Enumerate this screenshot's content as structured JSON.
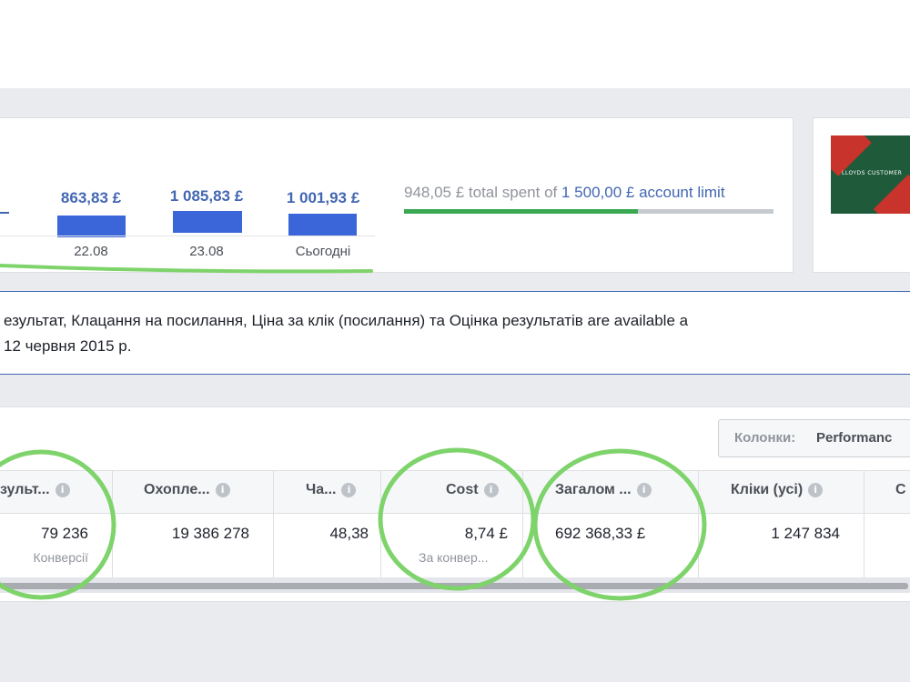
{
  "spend_chart": {
    "bars": [
      {
        "value": "863,83 £",
        "date": "22.08"
      },
      {
        "value": "1 085,83 £",
        "date": "23.08"
      },
      {
        "value": "1 001,93 £",
        "date": "Сьогодні"
      }
    ]
  },
  "account_spend": {
    "spent_amount": "948,05 £",
    "spent_text": " total spent of ",
    "limit_amount": "1 500,00 £",
    "limit_text": " account limit",
    "progress_fraction": 0.632
  },
  "ad_preview": {
    "logo_text": "LLOYDS CUSTOMER"
  },
  "notice": {
    "line1": "езультат, Клацання на посилання, Ціна за клік (посилання) та Оцінка результатів are available a",
    "line2": " 12 червня 2015 р."
  },
  "columns_button": {
    "label": "Колонки:",
    "value": "Performanc"
  },
  "table": {
    "info_symbol": "i",
    "headers": [
      {
        "label": "зульт...",
        "info": true
      },
      {
        "label": "Охопле...",
        "info": true
      },
      {
        "label": "Ча...",
        "info": true
      },
      {
        "label": "Cost",
        "info": true
      },
      {
        "label": "Загалом ...",
        "info": true
      },
      {
        "label": "Кліки (усі)",
        "info": true
      },
      {
        "label": "C",
        "info": false
      }
    ],
    "row": [
      {
        "value": "79 236",
        "sub": "Конверсії"
      },
      {
        "value": "19 386 278",
        "sub": ""
      },
      {
        "value": "48,38",
        "sub": ""
      },
      {
        "value": "8,74 £",
        "sub": "За конвер..."
      },
      {
        "value": "692 368,33 £",
        "sub": ""
      },
      {
        "value": "1 247 834",
        "sub": ""
      },
      {
        "value": "",
        "sub": ""
      }
    ]
  },
  "colors": {
    "accent_blue": "#4267b2",
    "bar_blue": "#3b66d9",
    "progress_green": "#3aa852",
    "annotation_green": "#7ed36b"
  }
}
